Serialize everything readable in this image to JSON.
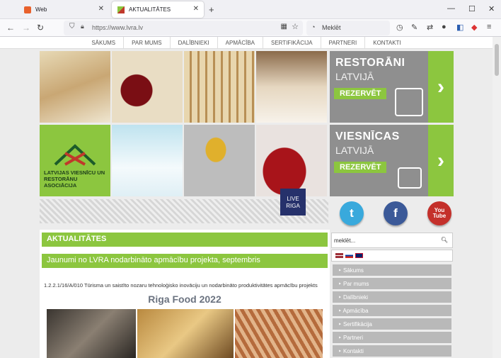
{
  "browser": {
    "tabs": [
      {
        "title": "Web",
        "active": false
      },
      {
        "title": "AKTUALITĀTES",
        "active": true
      }
    ],
    "url": "https://www.lvra.lv",
    "search_placeholder": "Meklēt"
  },
  "site": {
    "menu": [
      "SĀKUMS",
      "PAR MUMS",
      "DALĪBNIEKI",
      "APMĀCĪBA",
      "SERTIFIKĀCIJA",
      "PARTNERI",
      "KONTAKTI"
    ],
    "banner1": {
      "line1": "RESTORĀNI",
      "line2": "LATVIJĀ",
      "button": "REZERVĒT"
    },
    "banner2": {
      "line1": "VIESNĪCAS",
      "line2": "LATVIJĀ",
      "button": "REZERVĒT"
    },
    "logo_text": "LATVIJAS VIESNĪCU UN RESTORĀNU ASOCIĀCIJA",
    "liveriga": "LIVE RIGA",
    "section_title": "AKTUALITĀTES",
    "article_title": "Jaunumi no LVRA nodarbināto apmācību projekta, septembris",
    "project_text": "1.2.2.1/16/A/010 Tūrisma un saistīto nozaru tehnoloģisko inovāciju un nodarbināto produktivitātes apmācību projekts",
    "event_title": "Riga Food 2022",
    "search_value": "meklēt...",
    "sidebar_menu": [
      "Sākums",
      "Par mums",
      "Dalībnieki",
      "Apmācība",
      "Sertifikācija",
      "Partneri",
      "Kontakti"
    ],
    "social": [
      "twitter-icon",
      "facebook-icon",
      "youtube-icon"
    ]
  },
  "colors": {
    "accent_green": "#8cc63f",
    "banner_gray": "#8f8f8f",
    "sidebar_gray": "#b9b9b9"
  }
}
